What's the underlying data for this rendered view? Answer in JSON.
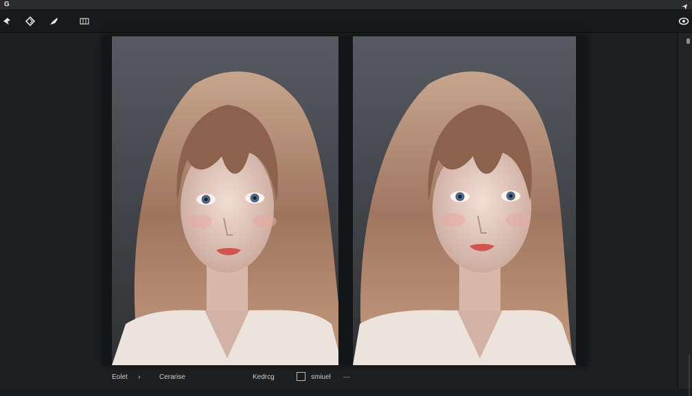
{
  "app": {
    "logo": "G"
  },
  "toolbar": {
    "buttons": [
      "pin-icon",
      "layers-icon",
      "brush-icon",
      "grid-icon"
    ]
  },
  "status": {
    "left_label": "Eolet",
    "left_arrow": "›",
    "middle_label": "Cerarise",
    "right_label": "Kedrcg",
    "checkbox_label": "smiuel"
  },
  "colors": {
    "background": "#1b1c1e",
    "panel_top": "#575a60",
    "hair": "#b2856a",
    "skin": "#ead2c7"
  }
}
